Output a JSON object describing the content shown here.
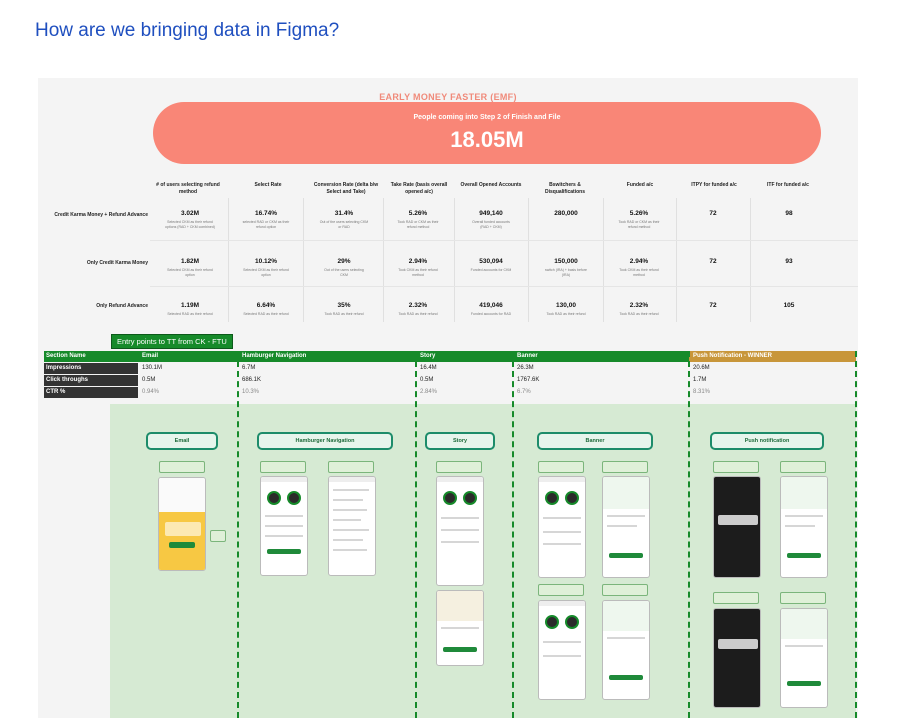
{
  "page": {
    "title": "How are we bringing data in Figma?"
  },
  "emf": {
    "title": "EARLY MONEY FASTER (EMF)",
    "banner_subtitle": "People coming into Step 2 of Finish and File",
    "banner_value": "18.05M"
  },
  "metrics": {
    "headers": [
      "# of users selecting refund method",
      "Select Rate",
      "Conversion Rate (delta b/w Select and Take)",
      "Take Rate (basis overall opened a/c)",
      "Overall Opened Accounts",
      "Bswitchers & Disqualifications",
      "Funded a/c",
      "ITPY for funded a/c",
      "ITF for funded a/c"
    ],
    "rows": [
      {
        "label": "Credit Karma Money + Refund Advance",
        "values": [
          "3.02M",
          "16.74%",
          "31.4%",
          "5.26%",
          "949,140",
          "280,000",
          "5.26%",
          "72",
          "98"
        ]
      },
      {
        "label": "Only Credit Karma Money",
        "values": [
          "1.82M",
          "10.12%",
          "29%",
          "2.94%",
          "530,094",
          "150,000",
          "2.94%",
          "72",
          "93"
        ]
      },
      {
        "label": "Only Refund Advance",
        "values": [
          "1.19M",
          "6.64%",
          "35%",
          "2.32%",
          "419,046",
          "130,00",
          "2.32%",
          "72",
          "105"
        ]
      }
    ]
  },
  "entry_label": "Entry points to TT from CK - FTU",
  "sections": {
    "header_label": "Section Name",
    "columns": [
      "Email",
      "Hamburger Navigation",
      "Story",
      "Banner",
      "Push Notification - WINNER"
    ],
    "rows": [
      {
        "label": "Impressions",
        "values": [
          "130.1M",
          "6.7M",
          "16.4M",
          "26.3M",
          "20.6M"
        ]
      },
      {
        "label": "Click throughs",
        "values": [
          "0.5M",
          "686.1K",
          "0.5M",
          "1767.6K",
          "1.7M"
        ]
      },
      {
        "label": "CTR %",
        "values": [
          "0.94%",
          "10.3%",
          "2.84%",
          "6.7%",
          "8.31%"
        ]
      }
    ]
  },
  "flow": {
    "titles": [
      "Email",
      "Hamburger Navigation",
      "Story",
      "Banner",
      "Push notification"
    ]
  },
  "colors": {
    "accent_green": "#168a2a",
    "banner_coral": "#f98677",
    "winner_gold": "#c8963a",
    "title_blue": "#1f4fbf"
  }
}
